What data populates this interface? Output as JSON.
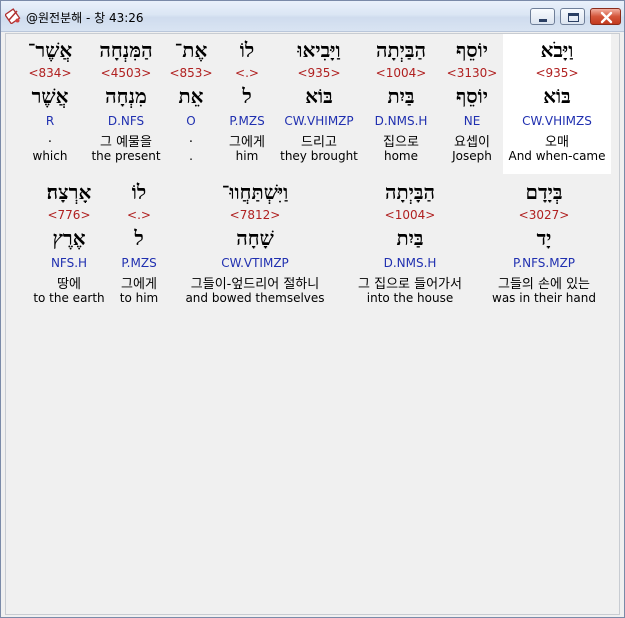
{
  "window": {
    "title": "@원전분해 - 창 43:26"
  },
  "colors": {
    "strong": "#b02020",
    "morph": "#2030b0",
    "highlight": "#ffffff"
  },
  "icons": {
    "app": "book-pen-icon",
    "minimize": "minimize-icon",
    "maximize": "maximize-icon",
    "close": "close-icon"
  },
  "rows": [
    {
      "words": [
        {
          "heb": "וַיָּבֹא",
          "strong": "<935>",
          "lemma": "בּוֹא",
          "morph": "CW.VHIMZS",
          "kor": "오매",
          "eng": "And when-came",
          "highlight": true
        },
        {
          "heb": "יוֹסֵף",
          "strong": "<3130>",
          "lemma": "יוֹסֵף",
          "morph": "NE",
          "kor": "요셉이",
          "eng": "Joseph"
        },
        {
          "heb": "הַבַּיְתָה",
          "strong": "<1004>",
          "lemma": "בַּיִת",
          "morph": "D.NMS.H",
          "kor": "집으로",
          "eng": "home"
        },
        {
          "heb": "וַיָּבִיאוּ",
          "strong": "<935>",
          "lemma": "בּוֹא",
          "morph": "CW.VHIMZP",
          "kor": "드리고",
          "eng": "they brought"
        },
        {
          "heb": "לוֹ",
          "strong": "<.>",
          "lemma": "ל",
          "morph": "P.MZS",
          "kor": "그에게",
          "eng": "him"
        },
        {
          "heb": "אֶת־",
          "strong": "<853>",
          "lemma": "אֵת",
          "morph": "O",
          "kor": ".",
          "eng": "."
        },
        {
          "heb": "הַמִּנְחָה",
          "strong": "<4503>",
          "lemma": "מִנְחָה",
          "morph": "D.NFS",
          "kor": "그 예물을",
          "eng": "the present"
        },
        {
          "heb": "אֲשֶׁר־",
          "strong": "<834>",
          "lemma": "אֲשֶׁר",
          "morph": "R",
          "kor": ".",
          "eng": "which"
        }
      ]
    },
    {
      "words": [
        {
          "heb": "בְּיָדָם",
          "strong": "<3027>",
          "lemma": "יָד",
          "morph": "P.NFS.MZP",
          "kor": "그들의 손에 있는",
          "eng": "was in their hand"
        },
        {
          "heb": "הַבָּיְתָה",
          "strong": "<1004>",
          "lemma": "בַּיִת",
          "morph": "D.NMS.H",
          "kor": "그 집으로 들어가서",
          "eng": "into the house"
        },
        {
          "heb": "וַיִּשְׁתַּחֲווּ־",
          "strong": "<7812>",
          "lemma": "שָׁחָה",
          "morph": "CW.VTIMZP",
          "kor": "그들이-엎드리어 절하니",
          "eng": "and bowed themselves"
        },
        {
          "heb": "לוֹ",
          "strong": "<.>",
          "lemma": "ל",
          "morph": "P.MZS",
          "kor": "그에게",
          "eng": "to him"
        },
        {
          "heb": "אָרְצָה׃",
          "strong": "<776>",
          "lemma": "אֶרֶץ",
          "morph": "NFS.H",
          "kor": "땅에",
          "eng": "to the earth"
        }
      ]
    }
  ]
}
